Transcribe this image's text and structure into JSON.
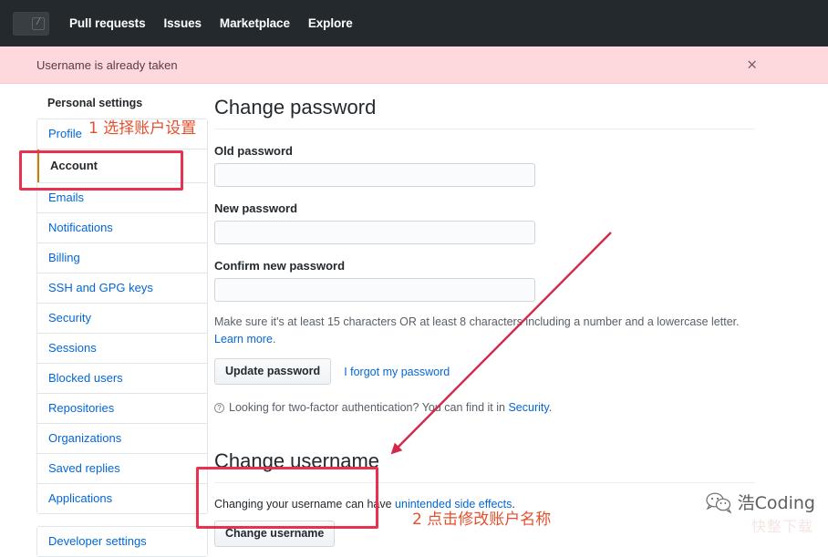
{
  "topnav": {
    "search_shortcut": "/",
    "links": [
      {
        "label": "Pull requests"
      },
      {
        "label": "Issues"
      },
      {
        "label": "Marketplace"
      },
      {
        "label": "Explore"
      }
    ]
  },
  "flash": {
    "message": "Username is already taken",
    "close_label": "×"
  },
  "sidebar": {
    "heading": "Personal settings",
    "groups": [
      {
        "items": [
          {
            "label": "Profile",
            "selected": false
          },
          {
            "label": "Account",
            "selected": true
          },
          {
            "label": "Emails",
            "selected": false
          },
          {
            "label": "Notifications",
            "selected": false
          },
          {
            "label": "Billing",
            "selected": false
          },
          {
            "label": "SSH and GPG keys",
            "selected": false
          },
          {
            "label": "Security",
            "selected": false
          },
          {
            "label": "Sessions",
            "selected": false
          },
          {
            "label": "Blocked users",
            "selected": false
          },
          {
            "label": "Repositories",
            "selected": false
          },
          {
            "label": "Organizations",
            "selected": false
          },
          {
            "label": "Saved replies",
            "selected": false
          },
          {
            "label": "Applications",
            "selected": false
          }
        ]
      },
      {
        "items": [
          {
            "label": "Developer settings",
            "selected": false
          }
        ]
      }
    ]
  },
  "password_section": {
    "title": "Change password",
    "old_password_label": "Old password",
    "old_password_value": "",
    "new_password_label": "New password",
    "new_password_value": "",
    "confirm_password_label": "Confirm new password",
    "confirm_password_value": "",
    "helper_text": "Make sure it's at least 15 characters OR at least 8 characters including a number and a lowercase letter. ",
    "helper_link": "Learn more",
    "helper_tail": ".",
    "update_button": "Update password",
    "forgot_link": "I forgot my password",
    "twofa_prefix": "Looking for two-factor authentication? You can find it in ",
    "twofa_link": "Security",
    "twofa_tail": "."
  },
  "username_section": {
    "title": "Change username",
    "note_prefix": "Changing your username can have ",
    "note_link": "unintended side effects",
    "note_tail": ".",
    "change_button": "Change username"
  },
  "annotations": [
    {
      "id": "step1",
      "text": "1 选择账户设置"
    },
    {
      "id": "step2",
      "text": "2 点击修改账户名称"
    }
  ],
  "watermark": {
    "brand": "浩Coding",
    "faint": "快整下载"
  },
  "colors": {
    "header_bg": "#24292e",
    "flash_bg": "#fdd9dd",
    "link": "#0366d6",
    "annotation_box": "#e8314f",
    "annotation_text": "#e2502e",
    "selected_marker": "#c98000"
  }
}
